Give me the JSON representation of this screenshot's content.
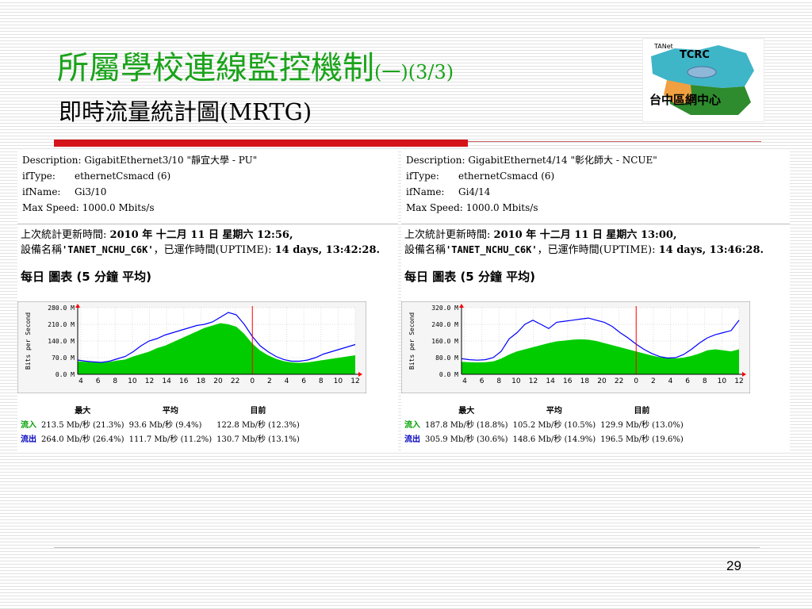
{
  "slide": {
    "title": "所屬學校連線監控機制",
    "title_suffix": "(一)(3/3)",
    "subtitle": "即時流量統計圖(MRTG)",
    "page_number": "29"
  },
  "logo": {
    "tanet": "TANet",
    "tcrc": "TCRC",
    "caption": "台中區網中心"
  },
  "panels": [
    {
      "description_label": "Description:",
      "description": "GigabitEthernet3/10 \"靜宜大學 - PU\"",
      "iftype_label": "ifType:",
      "iftype": "ethernetCsmacd (6)",
      "ifname_label": "ifName:",
      "ifname": "Gi3/10",
      "maxspeed_label": "Max Speed:",
      "maxspeed": "1000.0 Mbits/s",
      "update_prefix": "上次統計更新時間:",
      "update_time": "2010 年 十二月 11 日 星期六 12:56,",
      "device_prefix": "設備名稱",
      "device_name": "'TANET_NCHU_C6K'",
      "uptime_prefix": "，已運作時間(UPTIME):",
      "uptime": "14 days, 13:42:28.",
      "daily_title": "每日 圖表 (5 分鐘 平均)",
      "stats_headers": [
        "最大",
        "平均",
        "目前"
      ],
      "in_label": "流入",
      "out_label": "流出",
      "in_values": [
        "213.5 Mb/秒 (21.3%)",
        "93.6 Mb/秒 (9.4%)",
        "122.8 Mb/秒 (12.3%)"
      ],
      "out_values": [
        "264.0 Mb/秒 (26.4%)",
        "111.7 Mb/秒 (11.2%)",
        "130.7 Mb/秒 (13.1%)"
      ]
    },
    {
      "description_label": "Description:",
      "description": "GigabitEthernet4/14 \"彰化師大 - NCUE\"",
      "iftype_label": "ifType:",
      "iftype": "ethernetCsmacd (6)",
      "ifname_label": "ifName:",
      "ifname": "Gi4/14",
      "maxspeed_label": "Max Speed:",
      "maxspeed": "1000.0 Mbits/s",
      "update_prefix": "上次統計更新時間:",
      "update_time": "2010 年 十二月 11 日 星期六 13:00,",
      "device_prefix": "設備名稱",
      "device_name": "'TANET_NCHU_C6K'",
      "uptime_prefix": "，已運作時間(UPTIME):",
      "uptime": "14 days, 13:46:28.",
      "daily_title": "每日 圖表 (5 分鐘 平均)",
      "stats_headers": [
        "最大",
        "平均",
        "目前"
      ],
      "in_label": "流入",
      "out_label": "流出",
      "in_values": [
        "187.8 Mb/秒 (18.8%)",
        "105.2 Mb/秒 (10.5%)",
        "129.9 Mb/秒 (13.0%)"
      ],
      "out_values": [
        "305.9 Mb/秒 (30.6%)",
        "148.6 Mb/秒 (14.9%)",
        "196.5 Mb/秒 (19.6%)"
      ]
    }
  ],
  "chart_data": [
    {
      "type": "area",
      "ylabel": "Bits per Second",
      "y_ticks": [
        "0.0 M",
        "70.0 M",
        "140.0 M",
        "210.0 M",
        "280.0 M"
      ],
      "ylim": [
        0,
        280
      ],
      "x_ticks": [
        "4",
        "6",
        "8",
        "10",
        "12",
        "14",
        "16",
        "18",
        "20",
        "22",
        "0",
        "2",
        "4",
        "6",
        "8",
        "10",
        "12"
      ],
      "grid": true,
      "series": [
        {
          "color": "#00cc00",
          "values": [
            55,
            52,
            50,
            48,
            52,
            58,
            62,
            75,
            85,
            95,
            110,
            120,
            135,
            150,
            165,
            180,
            195,
            205,
            215,
            210,
            200,
            170,
            130,
            100,
            80,
            65,
            55,
            50,
            48,
            50,
            55,
            60,
            65,
            70,
            75,
            80
          ]
        },
        {
          "color": "#0000ff",
          "values": [
            60,
            55,
            52,
            50,
            55,
            65,
            75,
            95,
            120,
            140,
            150,
            165,
            175,
            185,
            195,
            205,
            210,
            220,
            240,
            260,
            250,
            210,
            160,
            120,
            95,
            75,
            62,
            55,
            55,
            60,
            70,
            85,
            95,
            105,
            115,
            125
          ]
        }
      ]
    },
    {
      "type": "area",
      "ylabel": "Bits per Second",
      "y_ticks": [
        "0.0 M",
        "80.0 M",
        "160.0 M",
        "240.0 M",
        "320.0 M"
      ],
      "ylim": [
        0,
        320
      ],
      "x_ticks": [
        "4",
        "6",
        "8",
        "10",
        "12",
        "14",
        "16",
        "18",
        "20",
        "22",
        "0",
        "2",
        "4",
        "6",
        "8",
        "10",
        "12"
      ],
      "grid": true,
      "series": [
        {
          "color": "#00cc00",
          "values": [
            60,
            58,
            57,
            58,
            62,
            75,
            95,
            110,
            120,
            130,
            140,
            150,
            158,
            162,
            166,
            168,
            166,
            160,
            150,
            140,
            130,
            120,
            110,
            100,
            90,
            82,
            78,
            76,
            80,
            88,
            100,
            115,
            120,
            115,
            110,
            120
          ]
        },
        {
          "color": "#0000ff",
          "values": [
            75,
            70,
            68,
            70,
            80,
            110,
            170,
            200,
            240,
            260,
            240,
            220,
            250,
            255,
            260,
            265,
            270,
            260,
            250,
            230,
            200,
            175,
            145,
            120,
            100,
            85,
            78,
            80,
            95,
            120,
            150,
            175,
            190,
            200,
            210,
            260
          ]
        }
      ]
    }
  ]
}
